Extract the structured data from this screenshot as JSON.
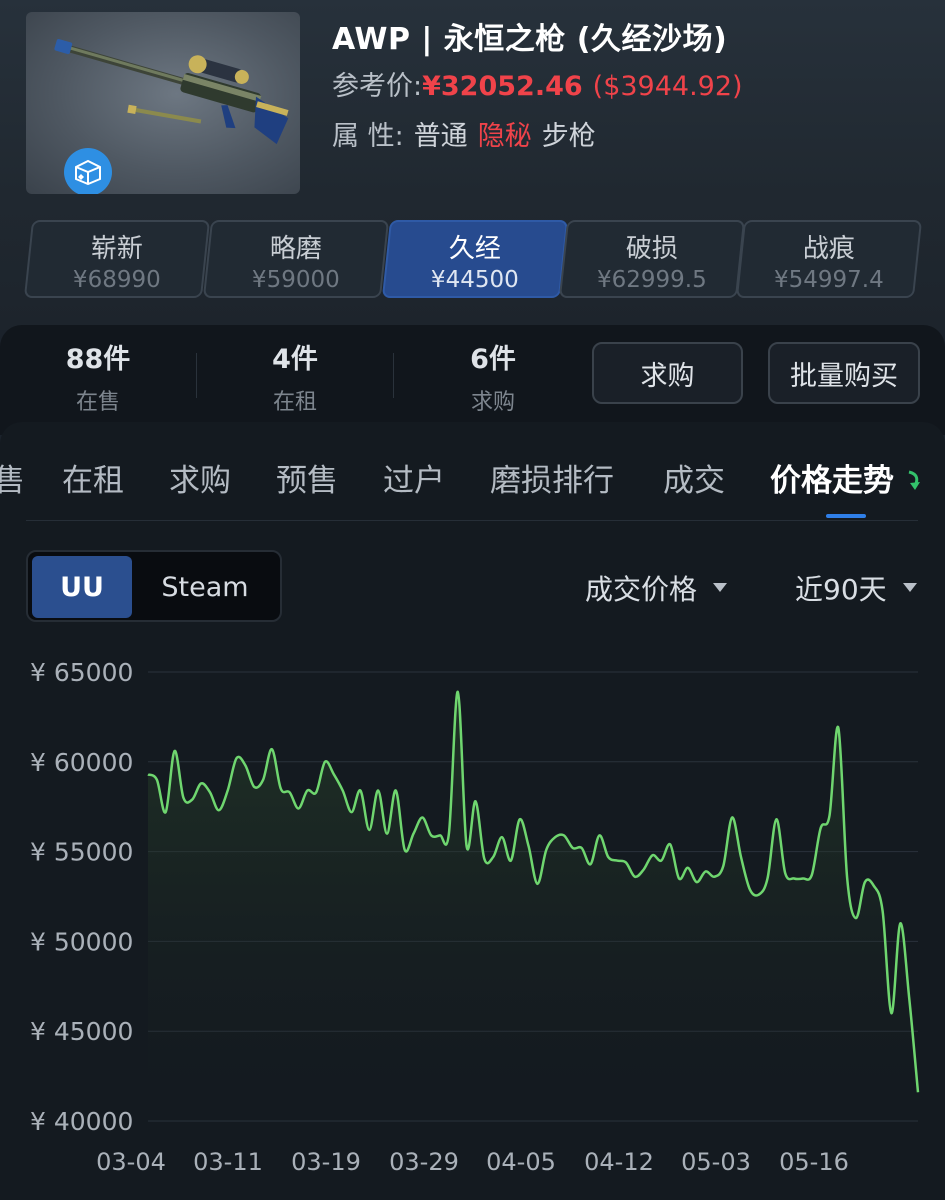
{
  "item": {
    "title": "AWP | 永恒之枪 (久经沙场)",
    "ref_label": "参考价:",
    "ref_price_cny": "¥32052.46",
    "ref_price_usd": "($3944.92)",
    "attr_label": "属  性:",
    "attr_quality": "普通",
    "attr_rarity": "隐秘",
    "attr_type": "步枪",
    "badge_icon": "case-icon"
  },
  "wear_tabs": [
    {
      "name": "崭新",
      "price": "¥68990"
    },
    {
      "name": "略磨",
      "price": "¥59000"
    },
    {
      "name": "久经",
      "price": "¥44500",
      "active": true
    },
    {
      "name": "破损",
      "price": "¥62999.5"
    },
    {
      "name": "战痕",
      "price": "¥54997.4"
    }
  ],
  "stats": [
    {
      "num": "88件",
      "label": "在售"
    },
    {
      "num": "4件",
      "label": "在租"
    },
    {
      "num": "6件",
      "label": "求购"
    }
  ],
  "actions": {
    "buy_request": "求购",
    "bulk_buy": "批量购买"
  },
  "sub_tabs": [
    "售",
    "在租",
    "求购",
    "预售",
    "过户",
    "磨损排行",
    "成交",
    "价格走势"
  ],
  "active_sub_tab": "价格走势",
  "source_toggle": {
    "options": [
      "UU",
      "Steam"
    ],
    "selected": "UU"
  },
  "filters": {
    "metric": "成交价格",
    "range": "近90天"
  },
  "colors": {
    "accent": "#2f7fe8",
    "price_red": "#f0434a",
    "line": "#6fd66f",
    "active_tab": "#274b8f"
  },
  "chart_data": {
    "type": "line",
    "title": "",
    "xlabel": "",
    "ylabel": "",
    "ylim": [
      40000,
      65000
    ],
    "y_ticks": [
      65000,
      60000,
      55000,
      50000,
      45000,
      40000
    ],
    "y_tick_labels": [
      "¥ 65000",
      "¥ 60000",
      "¥ 55000",
      "¥ 50000",
      "¥ 45000",
      "¥ 40000"
    ],
    "x_tick_labels": [
      "03-04",
      "03-11",
      "03-19",
      "03-29",
      "04-05",
      "04-12",
      "05-03",
      "05-16"
    ],
    "grid": true,
    "series": [
      {
        "values": [
          59300,
          59000,
          57200,
          60600,
          58000,
          57900,
          58800,
          58300,
          57300,
          58400,
          60200,
          59800,
          58600,
          59000,
          60700,
          58500,
          58300,
          57400,
          58400,
          58300,
          60000,
          59300,
          58400,
          57200,
          58400,
          56200,
          58400,
          56000,
          58400,
          55100,
          56000,
          56900,
          55900,
          55900,
          56000,
          63900,
          55300,
          57800,
          54600,
          54700,
          55800,
          54500,
          56800,
          55300,
          53200,
          55100,
          55800,
          55900,
          55200,
          55200,
          54300,
          55900,
          54700,
          54500,
          54400,
          53600,
          54000,
          54800,
          54500,
          55400,
          53500,
          54100,
          53300,
          53900,
          53600,
          54200,
          56900,
          54700,
          52900,
          52600,
          53500,
          56800,
          53800,
          53500,
          53500,
          53700,
          56300,
          57000,
          61900,
          53500,
          51300,
          53300,
          53100,
          51700,
          46000,
          51000,
          46900,
          41600
        ]
      }
    ]
  }
}
